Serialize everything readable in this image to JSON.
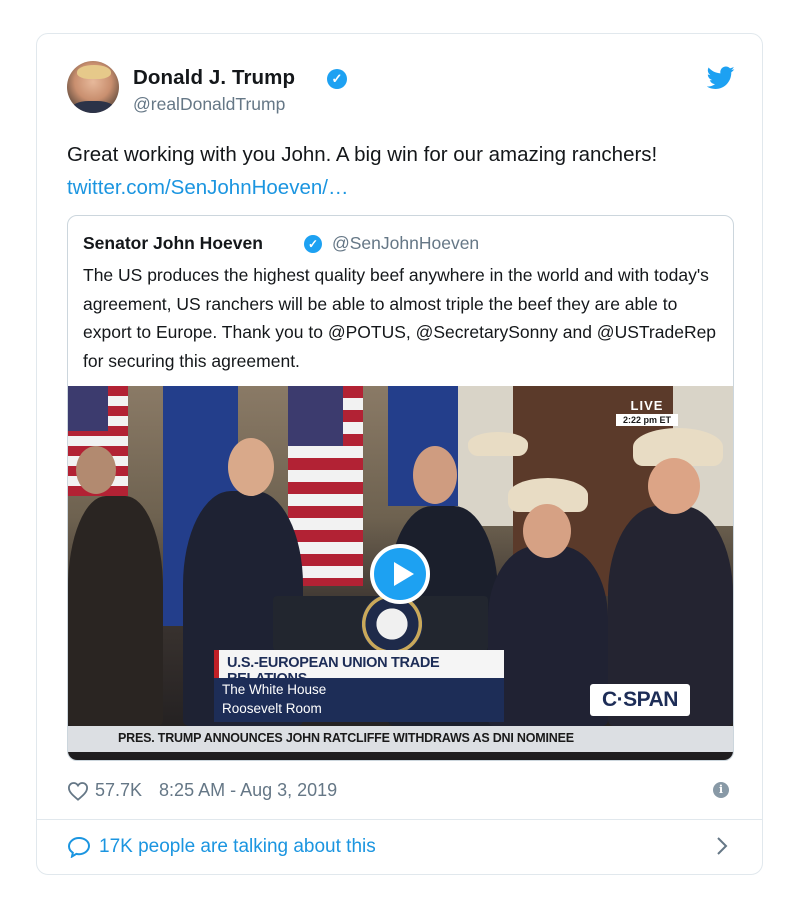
{
  "author": {
    "name": "Donald J. Trump",
    "handle": "@realDonaldTrump",
    "verified_mark": "✓",
    "avatar_icon": "avatar-portrait"
  },
  "tweet": {
    "text": "Great working with you John. A big win for our amazing ranchers!",
    "link": "twitter.com/SenJohnHoeven/…"
  },
  "quoted": {
    "name": "Senator John Hoeven",
    "handle": "@SenJohnHoeven",
    "verified_mark": "✓",
    "text": "The US produces the highest quality beef anywhere in the world and with today's agreement, US ranchers will be able to almost triple the beef they are able to export to Europe. Thank you to @POTUS, @SecretarySonny and @USTradeRep for securing this agreement.",
    "video": {
      "live_label": "LIVE",
      "live_time": "2:22 pm ET",
      "chyron": "U.S.-EUROPEAN UNION TRADE RELATIONS",
      "location_line1": "The White House",
      "location_line2": "Roosevelt Room",
      "network": "C·SPAN",
      "ticker": "PRES. TRUMP ANNOUNCES JOHN RATCLIFFE WITHDRAWS AS DNI NOMINEE",
      "play_icon": "play-icon"
    }
  },
  "footer": {
    "likes": "57.7K",
    "timestamp": "8:25 AM - Aug 3, 2019",
    "info_mark": "i",
    "talking": "17K people are talking about this"
  },
  "colors": {
    "accent": "#1da1f2",
    "link": "#1b95e0",
    "muted": "#657786",
    "border": "#e1e8ed"
  }
}
